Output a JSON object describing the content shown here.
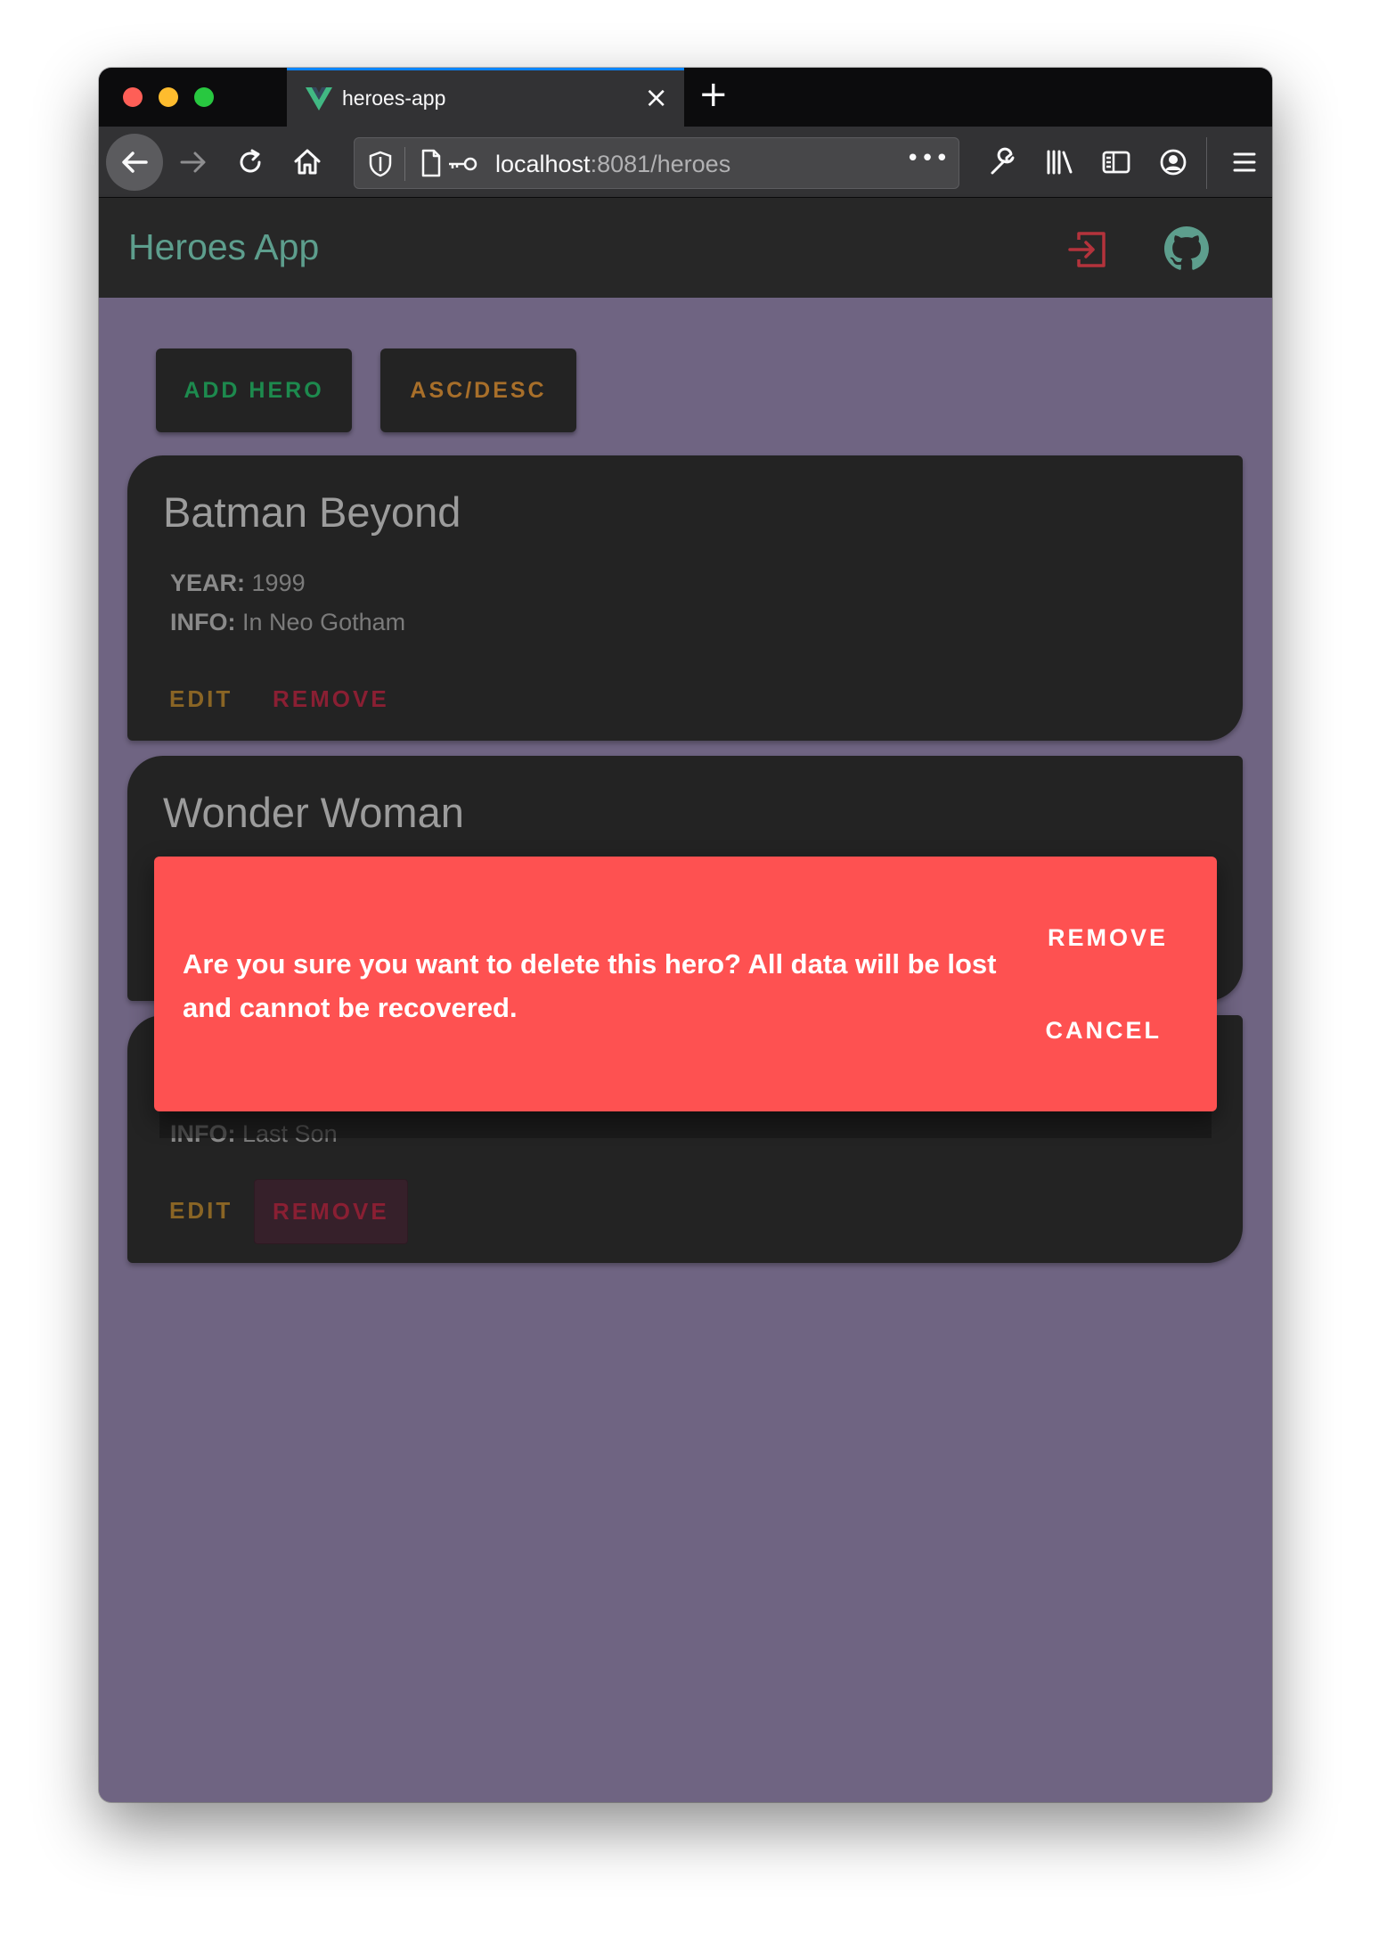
{
  "browser": {
    "tab_title": "heroes-app",
    "tab_close": "×",
    "new_tab": "+",
    "url_host": "localhost",
    "url_rest": ":8081/heroes",
    "url_more": "•••"
  },
  "app": {
    "title": "Heroes App",
    "accent_color": "#5d9e8d",
    "background_color": "#6f6482",
    "logout_icon": "logout-icon",
    "github_icon": "github-icon"
  },
  "toolbar": {
    "add_label": "ADD HERO",
    "sort_label": "ASC/DESC"
  },
  "heroes": [
    {
      "name": "Batman Beyond",
      "year_label": "YEAR:",
      "year": "1999",
      "info_label": "INFO:",
      "info": "In Neo Gotham",
      "edit_label": "EDIT",
      "remove_label": "REMOVE"
    },
    {
      "name": "Wonder Woman"
    },
    {
      "info_label": "INFO:",
      "info": "Last Son",
      "edit_label": "EDIT",
      "remove_label": "REMOVE"
    }
  ],
  "dialog": {
    "message": "Are you sure you want to delete this hero? All data will be lost and cannot be recovered.",
    "confirm_label": "REMOVE",
    "cancel_label": "CANCEL",
    "background_color": "#fe5151"
  }
}
